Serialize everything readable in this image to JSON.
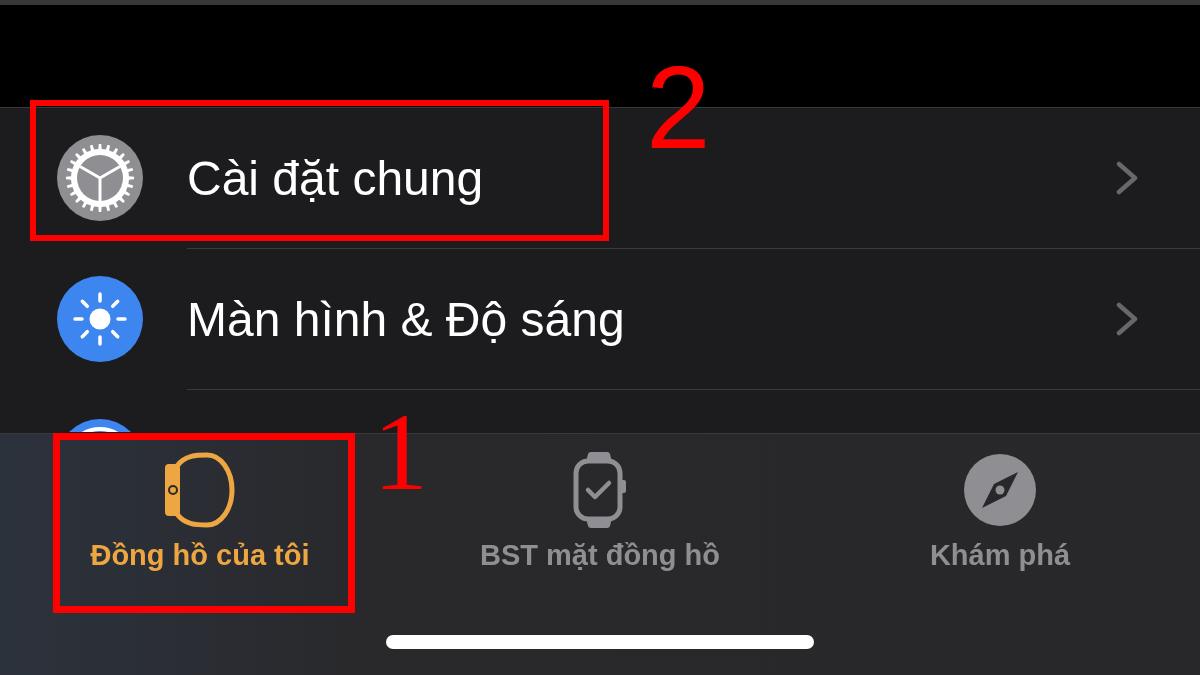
{
  "settings_list": {
    "rows": [
      {
        "label": "Cài đặt chung",
        "annotation": "2"
      },
      {
        "label": "Màn hình & Độ sáng"
      }
    ]
  },
  "tab_bar": {
    "tabs": [
      {
        "label": "Đồng hồ của tôi",
        "selected": true,
        "annotation": "1"
      },
      {
        "label": "BST mặt đồng hồ",
        "selected": false
      },
      {
        "label": "Khám phá",
        "selected": false
      }
    ]
  }
}
